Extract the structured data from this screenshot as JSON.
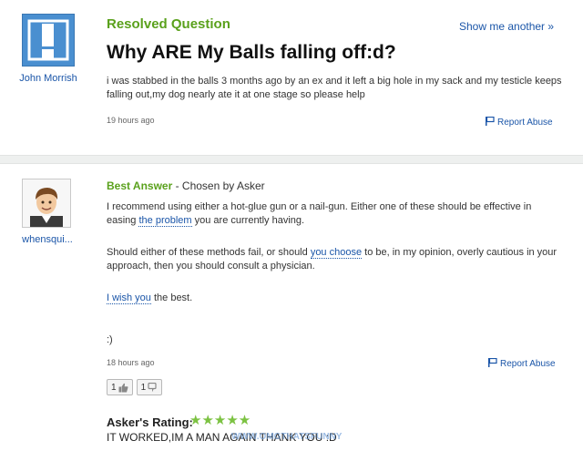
{
  "question": {
    "status": "Resolved Question",
    "show_another": "Show me another »",
    "title": "Why ARE My Balls falling off:d?",
    "body": "i was stabbed in the balls 3 months ago by an ex and it left a big hole in my sack and my testicle keeps falling out,my dog nearly ate it at one stage so please help",
    "time": "19 hours ago",
    "report": "Report Abuse",
    "asker": "John Morrish"
  },
  "answer": {
    "best_label": "Best Answer",
    "chosen_by": " - Chosen by Asker",
    "answerer": "whensqui...",
    "p1_a": "I recommend using either a hot-glue gun or a nail-gun. Either one of these should be effective in easing ",
    "p1_link": "the problem",
    "p1_b": " you are currently having.",
    "p2_a": "Should either of these methods fail, or should ",
    "p2_link": "you choose",
    "p2_b": " to be, in my opinion, overly cautious in your approach, then you should consult a physician.",
    "p3_link": "I wish you",
    "p3_b": " the best.",
    "p4": ":)",
    "time": "18 hours ago",
    "report": "Report Abuse",
    "thumbs_up": "1",
    "thumbs_down": "1",
    "rating_label": "Asker's Rating:",
    "stars": "★★★★★",
    "rating_value": 5,
    "rating_comment": "IT WORKED,IM A MAN AGAIN THANK YOU :D",
    "watermark": "WWW.OMGTHATSFUNNY"
  },
  "colors": {
    "accent_green": "#5aa11c",
    "link_blue": "#1a55a8",
    "star_green": "#7cc242"
  },
  "icons": [
    "question-avatar-icon",
    "flag-icon",
    "thumbs-up-icon",
    "thumbs-down-icon",
    "user-avatar-icon"
  ]
}
